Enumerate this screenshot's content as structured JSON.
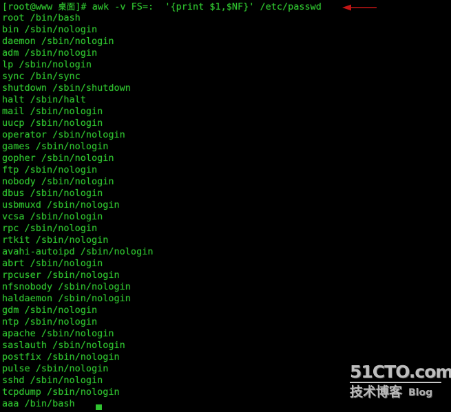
{
  "terminal": {
    "shell_prompt": {
      "user_host": "[root@www ",
      "directory": "桌面",
      "suffix": "]# ",
      "command": "awk -v FS=:  '{print $1,$NF}' /etc/passwd"
    },
    "prompt_full": "[root@www 桌面]# awk -v FS=:  '{print $1,$NF}' /etc/passwd",
    "colors": {
      "background": "#000000",
      "foreground": "#2fc22f",
      "annotation_arrow": "#c21515",
      "watermark": "#cfcfcf"
    },
    "output_lines": [
      "root /bin/bash",
      "bin /sbin/nologin",
      "daemon /sbin/nologin",
      "adm /sbin/nologin",
      "lp /sbin/nologin",
      "sync /bin/sync",
      "shutdown /sbin/shutdown",
      "halt /sbin/halt",
      "mail /sbin/nologin",
      "uucp /sbin/nologin",
      "operator /sbin/nologin",
      "games /sbin/nologin",
      "gopher /sbin/nologin",
      "ftp /sbin/nologin",
      "nobody /sbin/nologin",
      "dbus /sbin/nologin",
      "usbmuxd /sbin/nologin",
      "vcsa /sbin/nologin",
      "rpc /sbin/nologin",
      "rtkit /sbin/nologin",
      "avahi-autoipd /sbin/nologin",
      "abrt /sbin/nologin",
      "rpcuser /sbin/nologin",
      "nfsnobody /sbin/nologin",
      "haldaemon /sbin/nologin",
      "gdm /sbin/nologin",
      "ntp /sbin/nologin",
      "apache /sbin/nologin",
      "saslauth /sbin/nologin",
      "postfix /sbin/nologin",
      "pulse /sbin/nologin",
      "sshd /sbin/nologin",
      "tcpdump /sbin/nologin",
      "aaa /bin/bash"
    ]
  },
  "annotation": {
    "arrow_direction": "left"
  },
  "watermark": {
    "site": "51CTO.com",
    "chinese": "技术博客",
    "blog_label": "Blog"
  }
}
